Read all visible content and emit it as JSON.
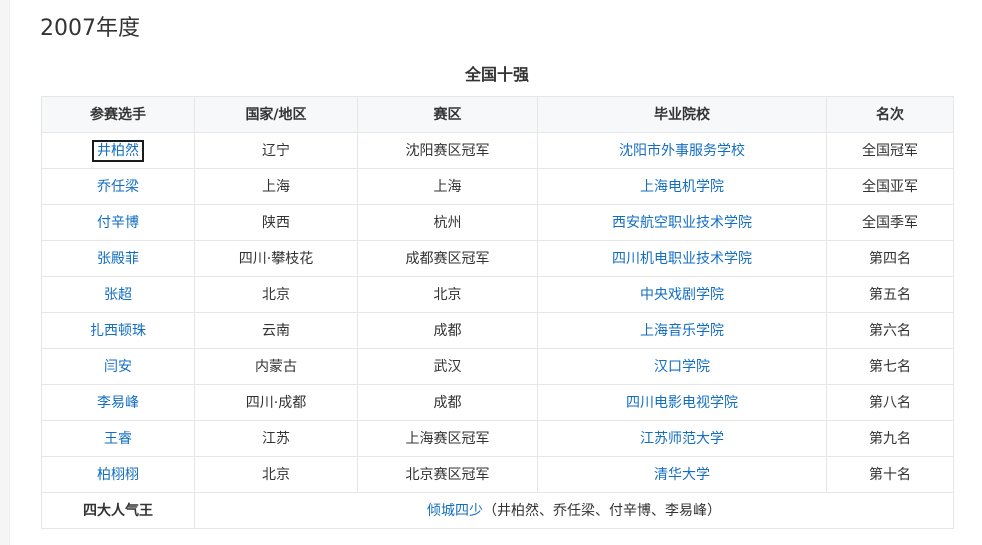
{
  "page": {
    "heading": "2007年度",
    "table_caption": "全国十强"
  },
  "columns": [
    "参赛选手",
    "国家/地区",
    "赛区",
    "毕业院校",
    "名次"
  ],
  "rows": [
    {
      "name": "井柏然",
      "region": "辽宁",
      "division": "沈阳赛区冠军",
      "school": "沈阳市外事服务学校",
      "rank": "全国冠军"
    },
    {
      "name": "乔任梁",
      "region": "上海",
      "division": "上海",
      "school": "上海电机学院",
      "rank": "全国亚军"
    },
    {
      "name": "付辛博",
      "region": "陕西",
      "division": "杭州",
      "school": "西安航空职业技术学院",
      "rank": "全国季军"
    },
    {
      "name": "张殿菲",
      "region": "四川·攀枝花",
      "division": "成都赛区冠军",
      "school": "四川机电职业技术学院",
      "rank": "第四名"
    },
    {
      "name": "张超",
      "region": "北京",
      "division": "北京",
      "school": "中央戏剧学院",
      "rank": "第五名"
    },
    {
      "name": "扎西顿珠",
      "region": "云南",
      "division": "成都",
      "school": "上海音乐学院",
      "rank": "第六名"
    },
    {
      "name": "闫安",
      "region": "内蒙古",
      "division": "武汉",
      "school": "汉口学院",
      "rank": "第七名"
    },
    {
      "name": "李易峰",
      "region": "四川·成都",
      "division": "成都",
      "school": "四川电影电视学院",
      "rank": "第八名"
    },
    {
      "name": "王睿",
      "region": "江苏",
      "division": "上海赛区冠军",
      "school": "江苏师范大学",
      "rank": "第九名"
    },
    {
      "name": "柏栩栩",
      "region": "北京",
      "division": "北京赛区冠军",
      "school": "清华大学",
      "rank": "第十名"
    }
  ],
  "footer": {
    "label": "四大人气王",
    "group_link": "倾城四少",
    "members": "（井柏然、乔任梁、付辛博、李易峰）"
  },
  "colors": {
    "link": "#136ec2",
    "header_bg": "#f7f8fa",
    "border": "#e6e6e6"
  }
}
